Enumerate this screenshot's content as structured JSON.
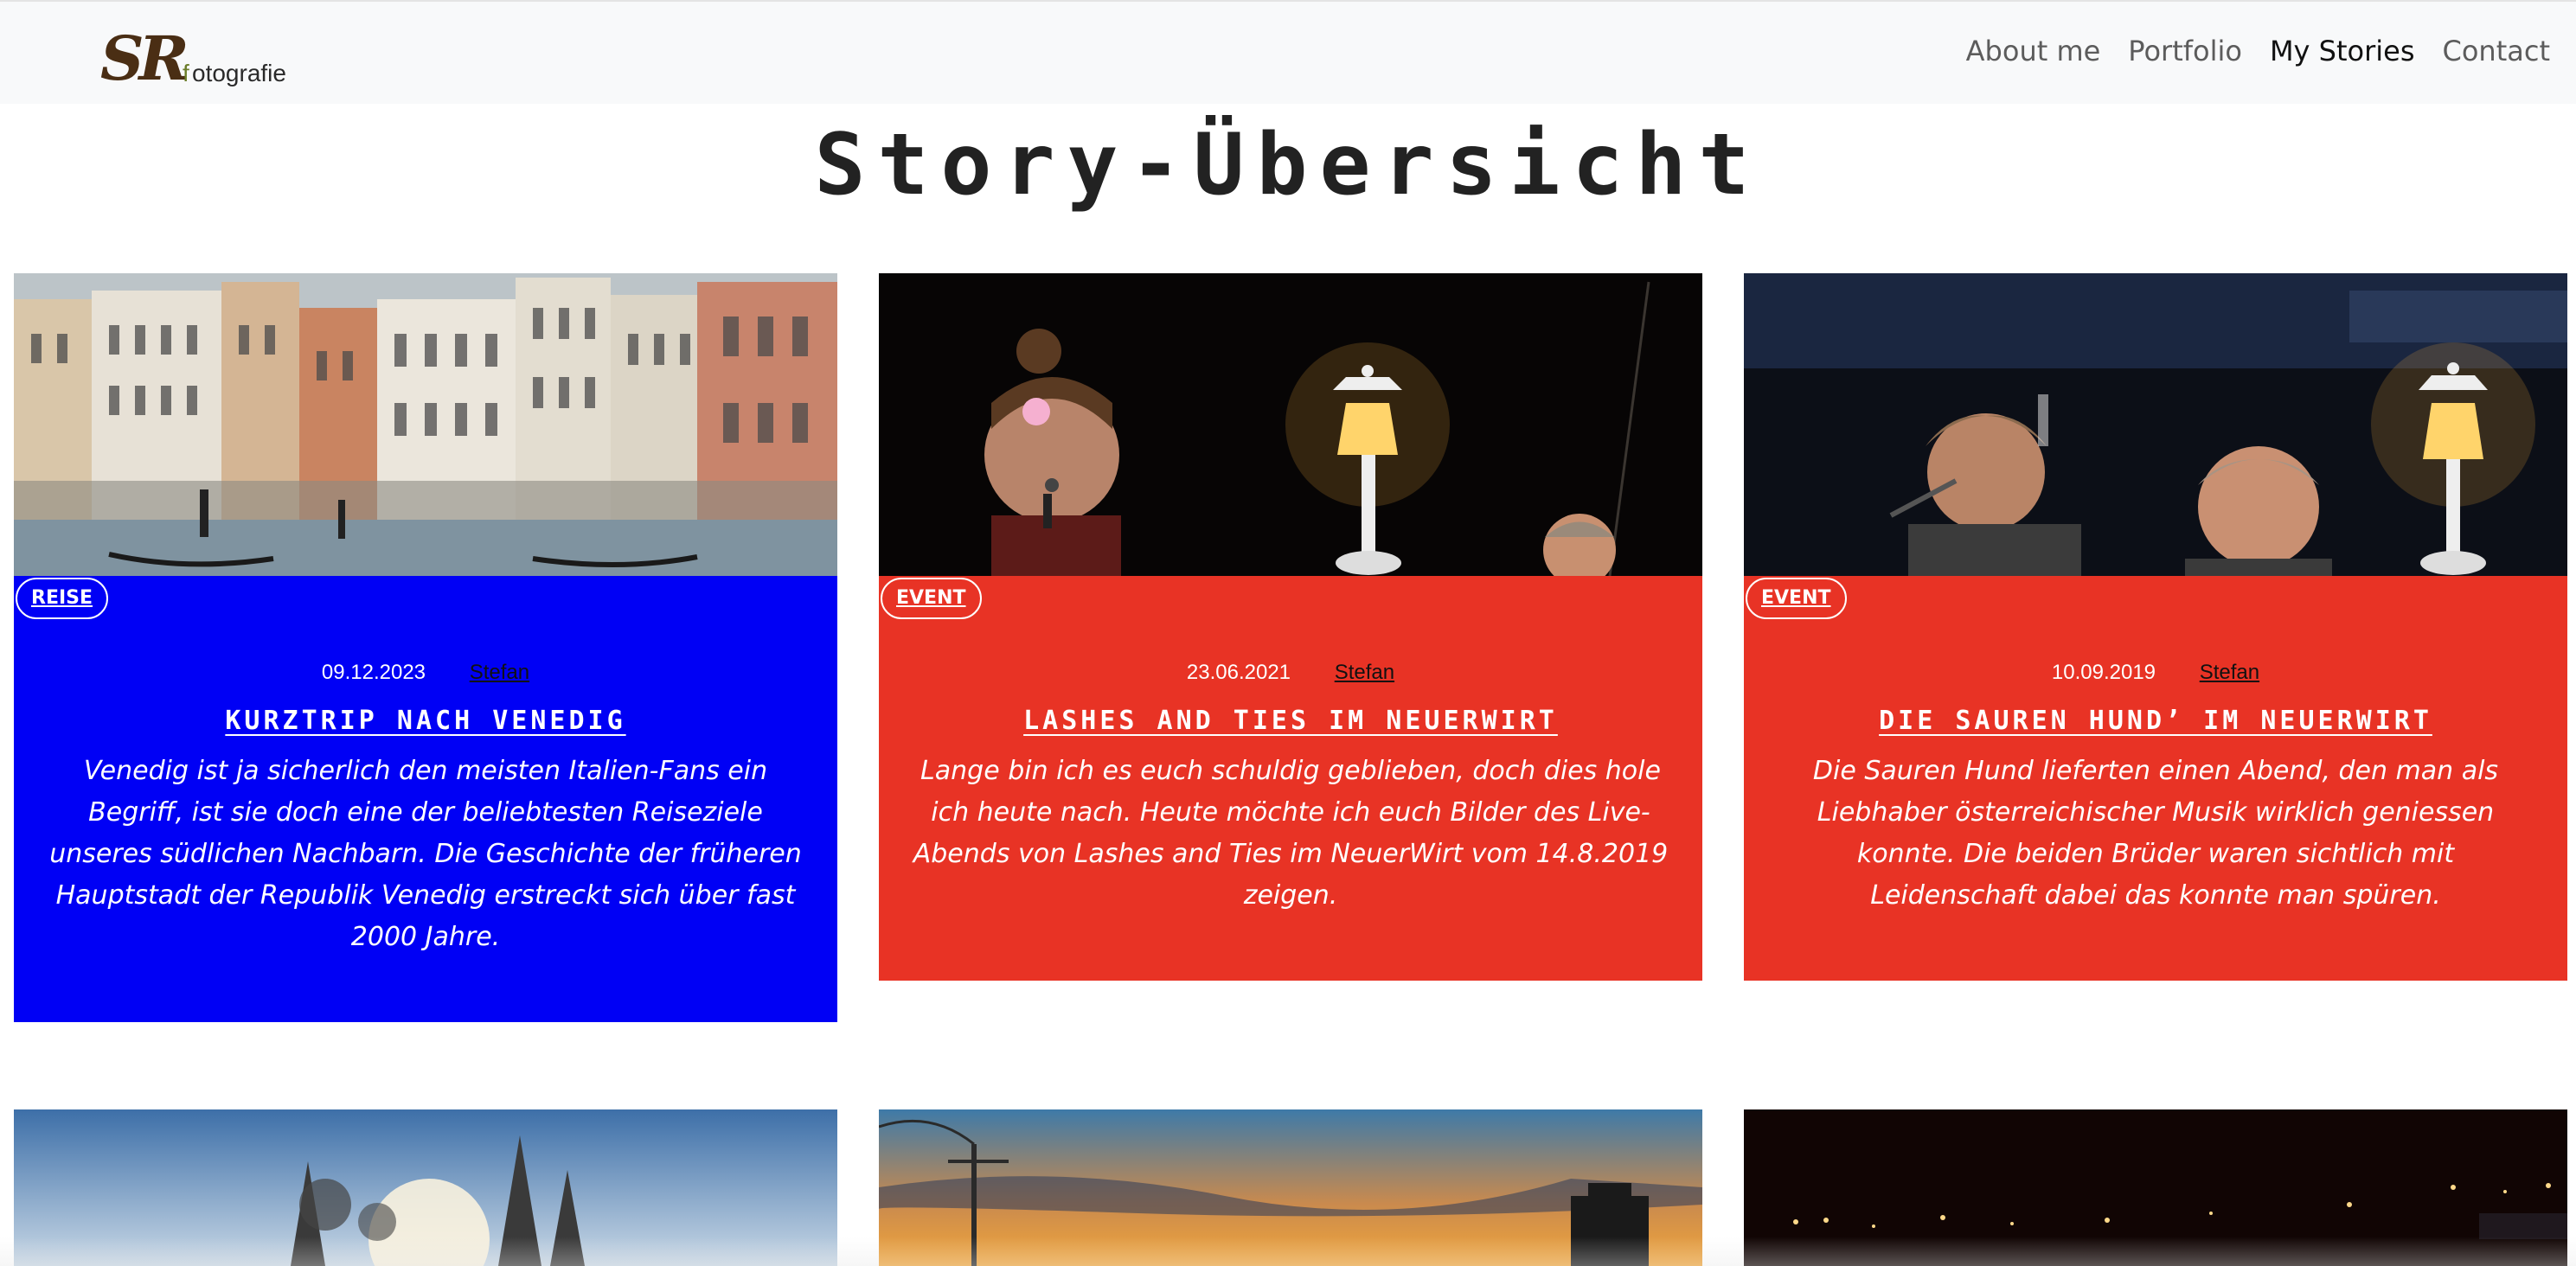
{
  "nav": {
    "logo_text": "SRFotografie",
    "links": [
      "About me",
      "Portfolio",
      "My Stories",
      "Contact"
    ],
    "active": "My Stories"
  },
  "page_title": "Story-Übersicht",
  "cards": [
    {
      "category": "REISE",
      "date": "09.12.2023",
      "author": "Stefan",
      "title": "Kurztrip nach Venedig",
      "text": "Venedig ist ja sicherlich den meisten Italien-Fans ein Begriff, ist sie doch eine der beliebtesten Reiseziele unseres südlichen Nachbarn. Die Geschichte der früheren Hauptstadt der Republik Venedig erstreckt sich über fast 2000 Jahre.",
      "bg_color": "#0000f5"
    },
    {
      "category": "EVENT",
      "date": "23.06.2021",
      "author": "Stefan",
      "title": "Lashes and Ties im NeuerWirt",
      "text": "Lange bin ich es euch schuldig geblieben, doch dies hole ich heute nach. Heute möchte ich euch Bilder des Live-Abends von Lashes and Ties im NeuerWirt vom 14.8.2019 zeigen.",
      "bg_color": "#e83325"
    },
    {
      "category": "EVENT",
      "date": "10.09.2019",
      "author": "Stefan",
      "title": "Die Sauren Hund’ im NeuerWirt",
      "text": "Die Sauren Hund lieferten einen Abend, den man als Liebhaber österreichischer Musik wirklich geniessen konnte. Die beiden Brüder waren sichtlich mit Leidenschaft dabei das konnte man spüren.",
      "bg_color": "#e83325"
    }
  ],
  "colors": {
    "navbar_bg": "#f8f9fa",
    "reise_blue": "#0000f5",
    "event_red": "#e83325"
  }
}
